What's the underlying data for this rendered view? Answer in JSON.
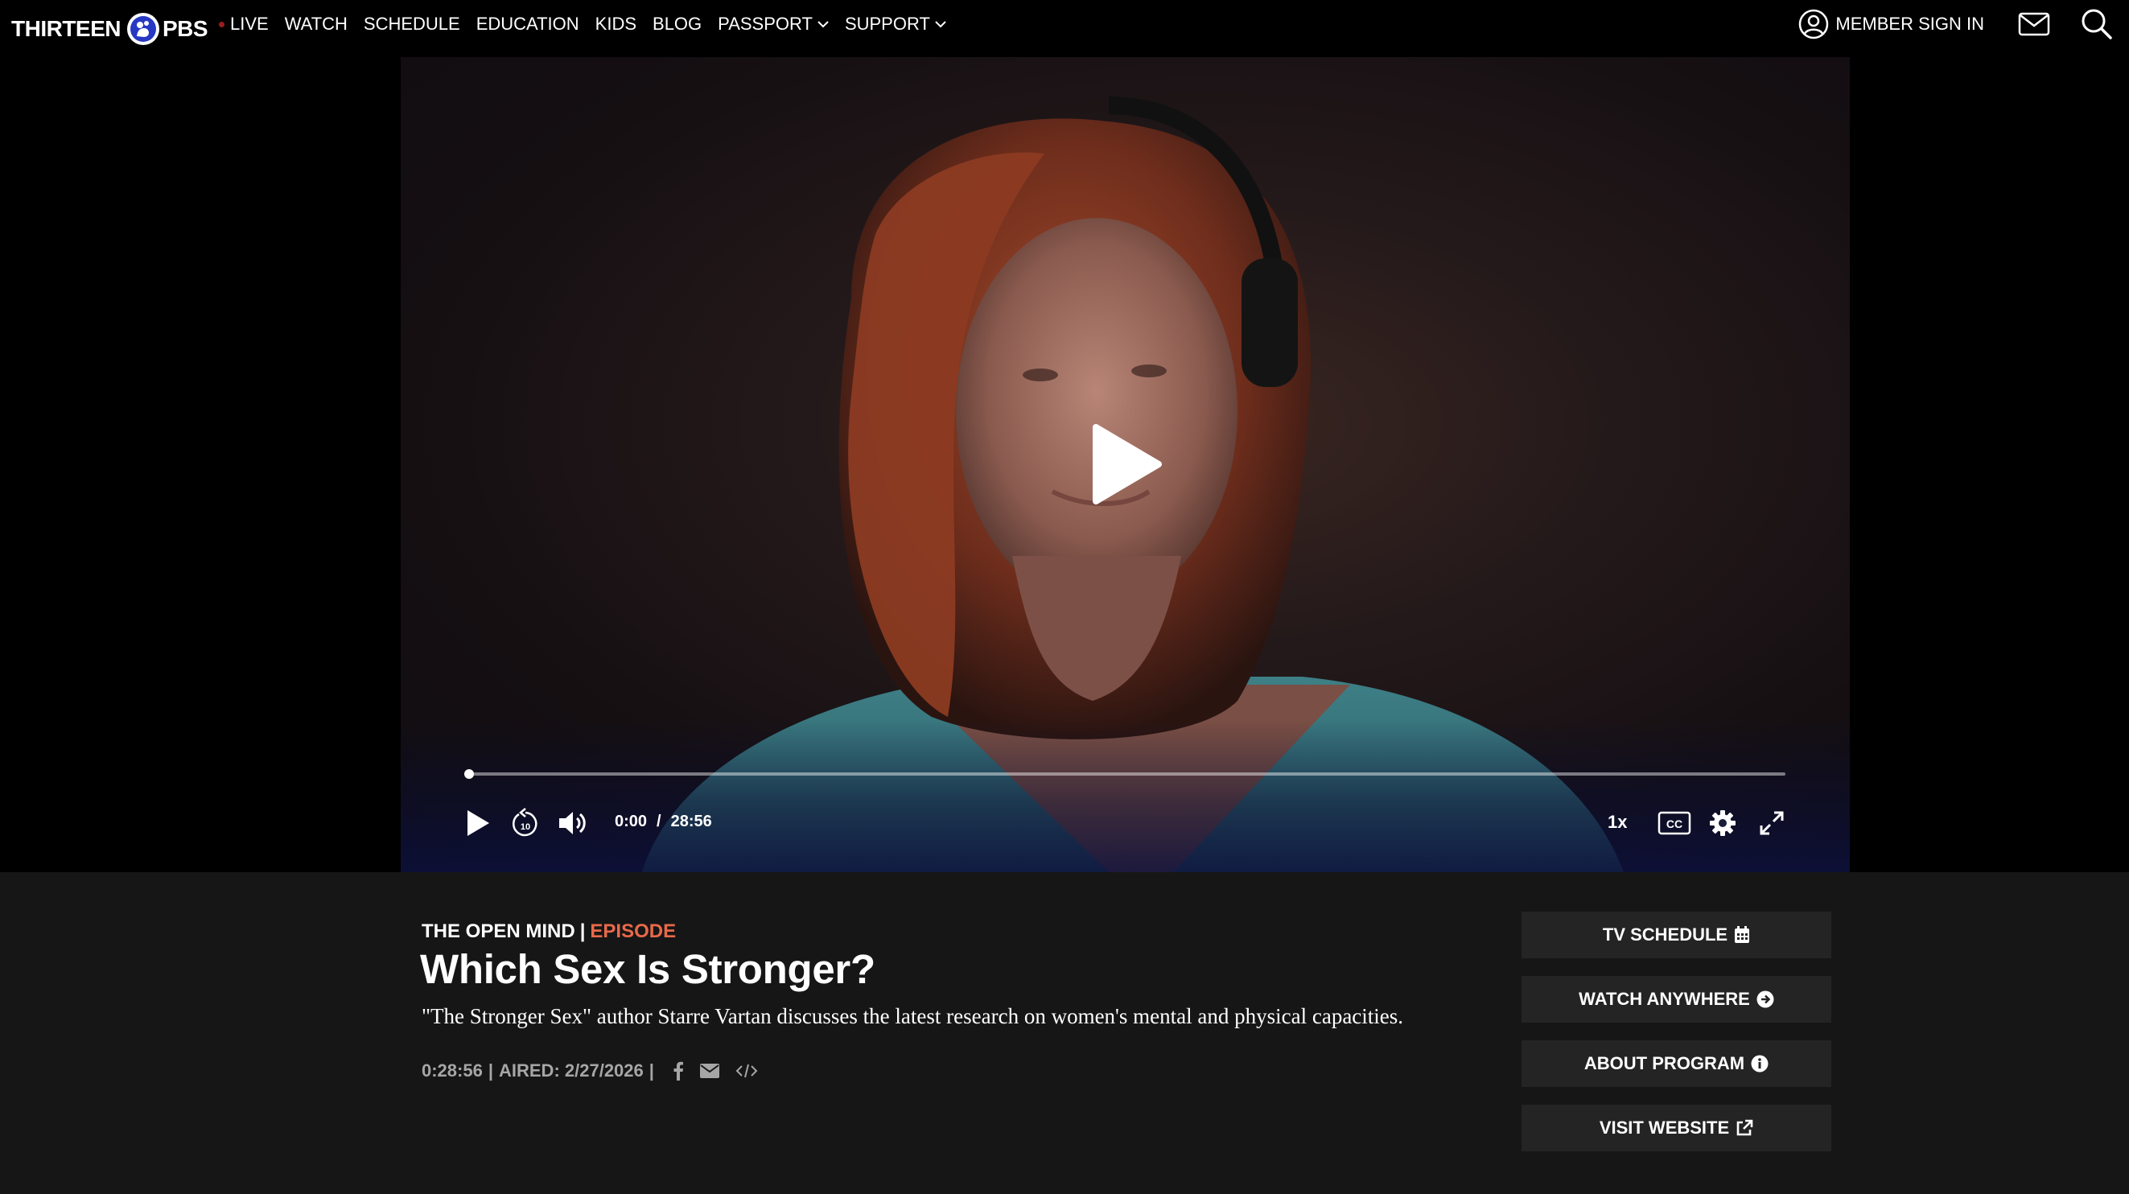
{
  "nav": {
    "brand_left": "THIRTEEN",
    "brand_right": "PBS",
    "links": [
      {
        "label": "LIVE"
      },
      {
        "label": "WATCH"
      },
      {
        "label": "SCHEDULE"
      },
      {
        "label": "EDUCATION"
      },
      {
        "label": "KIDS"
      },
      {
        "label": "BLOG"
      },
      {
        "label": "PASSPORT"
      },
      {
        "label": "SUPPORT"
      }
    ],
    "signin_label": "MEMBER SIGN IN",
    "icons": [
      "user-icon",
      "mail-icon",
      "search-icon"
    ]
  },
  "player": {
    "current_time": "0:00",
    "separator": "/",
    "duration": "28:56",
    "progress": 0,
    "speed": "1x",
    "cc_label": "CC",
    "rewind_label": "10",
    "icons": [
      "play-icon",
      "rewind-10-icon",
      "volume-icon",
      "cc-icon",
      "settings-icon",
      "fullscreen-icon"
    ]
  },
  "episode": {
    "show": "THE OPEN MIND",
    "pipe": "|",
    "type": "EPISODE",
    "title": "Which Sex Is Stronger?",
    "description": "\"The Stronger Sex\" author Starre Vartan discusses the latest research on women's mental and physical capacities.",
    "duration": "0:28:56",
    "sep": "|",
    "aired": "AIRED: 2/27/2026",
    "sep2": "|"
  },
  "sidebar": {
    "buttons": [
      {
        "label": "TV SCHEDULE",
        "icon": "calendar-icon"
      },
      {
        "label": "WATCH ANYWHERE",
        "icon": "arrow-circle-icon"
      },
      {
        "label": "ABOUT PROGRAM",
        "icon": "info-icon"
      },
      {
        "label": "VISIT WEBSITE",
        "icon": "external-link-icon"
      }
    ]
  },
  "colors": {
    "accent_episode": "#e8694a",
    "nav_bg": "#000000",
    "page_bg": "#161616",
    "button_bg": "#242424"
  }
}
